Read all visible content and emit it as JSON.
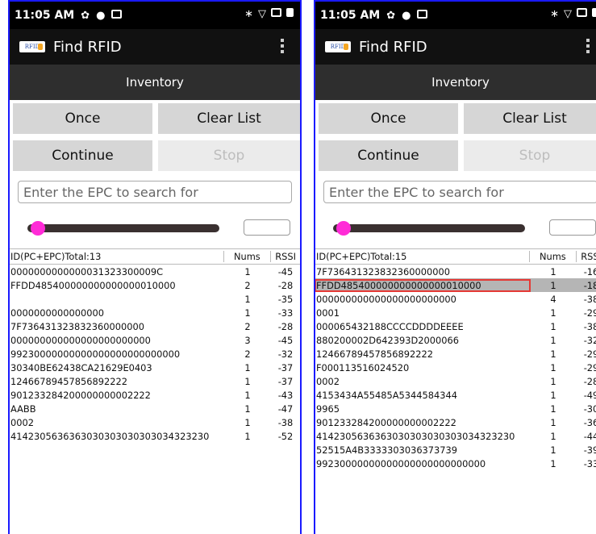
{
  "screens": [
    {
      "status": {
        "time": "11:05 AM"
      },
      "app_title": "Find RFID",
      "logo_text": "RFID",
      "tab_label": "Inventory",
      "buttons": {
        "once": "Once",
        "clear": "Clear List",
        "continue": "Continue",
        "stop": "Stop"
      },
      "search_placeholder": "Enter the EPC to search for",
      "power_level": 0.02,
      "table": {
        "headers": {
          "id": "ID(PC+EPC)Total:13",
          "nums": "Nums",
          "rssi": "RSSI"
        },
        "rows": [
          {
            "id": "0000000000000031323300009C",
            "nums": "1",
            "rssi": "-45"
          },
          {
            "id": "FFDD485400000000000000010000",
            "nums": "2",
            "rssi": "-28"
          },
          {
            "id": "",
            "nums": "1",
            "rssi": "-35"
          },
          {
            "id": "0000000000000000",
            "nums": "1",
            "rssi": "-33"
          },
          {
            "id": "7F736431323832360000000",
            "nums": "2",
            "rssi": "-28"
          },
          {
            "id": "000000000000000000000000",
            "nums": "3",
            "rssi": "-45"
          },
          {
            "id": "99230000000000000000000000000",
            "nums": "2",
            "rssi": "-32"
          },
          {
            "id": "30340BE62438CA21629E0403",
            "nums": "1",
            "rssi": "-37"
          },
          {
            "id": "12466789457856892222",
            "nums": "1",
            "rssi": "-37"
          },
          {
            "id": "901233284200000000002222",
            "nums": "1",
            "rssi": "-43"
          },
          {
            "id": "AABB",
            "nums": "1",
            "rssi": "-47"
          },
          {
            "id": "0002",
            "nums": "1",
            "rssi": "-38"
          },
          {
            "id": "4142305636363030303030303034323230",
            "nums": "1",
            "rssi": "-52"
          }
        ]
      }
    },
    {
      "status": {
        "time": "11:05 AM"
      },
      "app_title": "Find RFID",
      "logo_text": "RFID",
      "tab_label": "Inventory",
      "buttons": {
        "once": "Once",
        "clear": "Clear List",
        "continue": "Continue",
        "stop": "Stop"
      },
      "search_placeholder": "Enter the EPC to search for",
      "power_level": 0.02,
      "table": {
        "headers": {
          "id": "ID(PC+EPC)Total:15",
          "nums": "Nums",
          "rssi": "RSSI"
        },
        "rows": [
          {
            "id": "7F736431323832360000000",
            "nums": "1",
            "rssi": "-16"
          },
          {
            "id": "FFDD485400000000000000010000",
            "nums": "1",
            "rssi": "-18",
            "selected": true
          },
          {
            "id": "000000000000000000000000",
            "nums": "4",
            "rssi": "-38"
          },
          {
            "id": "0001",
            "nums": "1",
            "rssi": "-29"
          },
          {
            "id": "000065432188CCCCDDDDEEEE",
            "nums": "1",
            "rssi": "-38"
          },
          {
            "id": "880200002D642393D2000066",
            "nums": "1",
            "rssi": "-32"
          },
          {
            "id": "12466789457856892222",
            "nums": "1",
            "rssi": "-29"
          },
          {
            "id": "F000113516024520",
            "nums": "1",
            "rssi": "-29"
          },
          {
            "id": "0002",
            "nums": "1",
            "rssi": "-28"
          },
          {
            "id": "4153434A55485A5344584344",
            "nums": "1",
            "rssi": "-49"
          },
          {
            "id": "9965",
            "nums": "1",
            "rssi": "-30"
          },
          {
            "id": "901233284200000000002222",
            "nums": "1",
            "rssi": "-36"
          },
          {
            "id": "4142305636363030303030303034323230",
            "nums": "1",
            "rssi": "-44"
          },
          {
            "id": "52515A4B3333303036373739",
            "nums": "1",
            "rssi": "-39"
          },
          {
            "id": "99230000000000000000000000000",
            "nums": "1",
            "rssi": "-33"
          }
        ]
      }
    }
  ]
}
